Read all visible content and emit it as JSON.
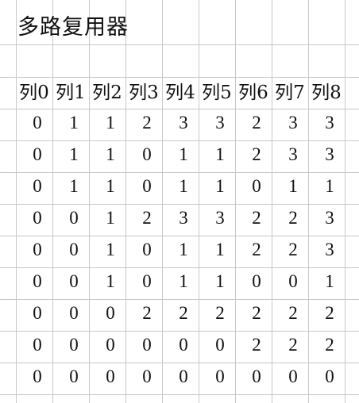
{
  "sheet": {
    "title": "多路复用器",
    "headers": [
      "列0",
      "列1",
      "列2",
      "列3",
      "列4",
      "列5",
      "列6",
      "列7",
      "列8"
    ],
    "rows": [
      [
        "0",
        "1",
        "1",
        "2",
        "3",
        "3",
        "2",
        "3",
        "3"
      ],
      [
        "0",
        "1",
        "1",
        "0",
        "1",
        "1",
        "2",
        "3",
        "3"
      ],
      [
        "0",
        "1",
        "1",
        "0",
        "1",
        "1",
        "0",
        "1",
        "1"
      ],
      [
        "0",
        "0",
        "1",
        "2",
        "3",
        "3",
        "2",
        "2",
        "3"
      ],
      [
        "0",
        "0",
        "1",
        "0",
        "1",
        "1",
        "2",
        "2",
        "3"
      ],
      [
        "0",
        "0",
        "1",
        "0",
        "1",
        "1",
        "0",
        "0",
        "1"
      ],
      [
        "0",
        "0",
        "0",
        "2",
        "2",
        "2",
        "2",
        "2",
        "2"
      ],
      [
        "0",
        "0",
        "0",
        "0",
        "0",
        "0",
        "2",
        "2",
        "2"
      ],
      [
        "0",
        "0",
        "0",
        "0",
        "0",
        "0",
        "0",
        "0",
        "0"
      ]
    ]
  }
}
